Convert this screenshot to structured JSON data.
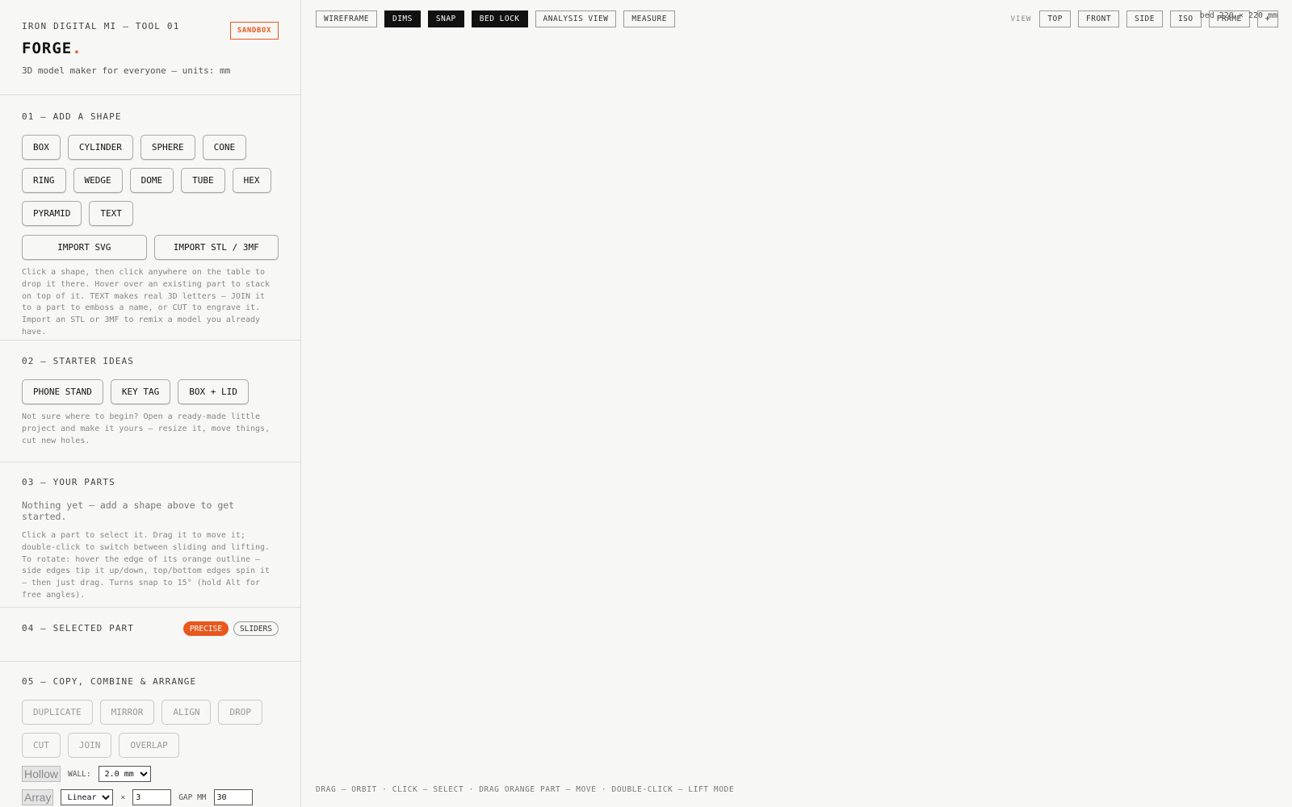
{
  "header": {
    "eyebrow": "IRON DIGITAL MI — TOOL 01",
    "brand": "FORGE",
    "brand_dot": ".",
    "subtitle": "3D model maker for everyone — units: mm",
    "badge": "SANDBOX"
  },
  "shapes": {
    "title": "01 — ADD A SHAPE",
    "items": [
      "BOX",
      "CYLINDER",
      "SPHERE",
      "CONE",
      "RING",
      "WEDGE",
      "DOME",
      "TUBE",
      "HEX",
      "PYRAMID",
      "TEXT"
    ],
    "import_svg": "IMPORT SVG",
    "import_stl": "IMPORT STL / 3MF",
    "help": "Click a shape, then click anywhere on the table to drop it there. Hover over an existing part to stack on top of it. TEXT makes real 3D letters — JOIN it to a part to emboss a name, or CUT to engrave it. Import an STL or 3MF to remix a model you already have."
  },
  "starter": {
    "title": "02 — STARTER IDEAS",
    "items": [
      "PHONE STAND",
      "KEY TAG",
      "BOX + LID"
    ],
    "help": "Not sure where to begin? Open a ready-made little project and make it yours — resize it, move things, cut new holes."
  },
  "parts": {
    "title": "03 — YOUR PARTS",
    "empty": "Nothing yet — add a shape above to get started.",
    "help": "Click a part to select it. Drag it to move it; double-click to switch between sliding and lifting. To rotate: hover the edge of its orange outline — side edges tip it up/down, top/bottom edges spin it — then just drag. Turns snap to 15° (hold Alt for free angles)."
  },
  "selected": {
    "title": "04 — SELECTED PART",
    "mode_precise": "PRECISE",
    "mode_sliders": "SLIDERS"
  },
  "arrange": {
    "title": "05 — COPY, COMBINE & ARRANGE",
    "items": [
      "DUPLICATE",
      "MIRROR",
      "ALIGN",
      "DROP",
      "CUT",
      "JOIN",
      "OVERLAP"
    ],
    "hollow_label": "Hollow",
    "wall_label": "WALL:",
    "wall_value": "2.0 mm",
    "array_label": "Array",
    "array_mode": "Linear",
    "times": "×",
    "count": "3",
    "gap_label": "GAP MM",
    "gap": "30"
  },
  "toolbar": {
    "items": [
      {
        "label": "WIREFRAME",
        "on": false
      },
      {
        "label": "DIMS",
        "on": true
      },
      {
        "label": "SNAP",
        "on": true
      },
      {
        "label": "BED LOCK",
        "on": true
      },
      {
        "label": "ANALYSIS VIEW",
        "on": false
      },
      {
        "label": "MEASURE",
        "on": false
      }
    ]
  },
  "viewbar": {
    "label": "VIEW",
    "items": [
      "TOP",
      "FRONT",
      "SIDE",
      "ISO",
      "FRAME",
      "+"
    ]
  },
  "bed": "bed 220 × 220 mm",
  "hint": "DRAG — ORBIT · CLICK — SELECT · DRAG ORANGE PART — MOVE · DOUBLE-CLICK — LIFT MODE",
  "colors": {
    "accent": "#e8571c",
    "ink": "#111111",
    "background": "#f7f7f6"
  }
}
